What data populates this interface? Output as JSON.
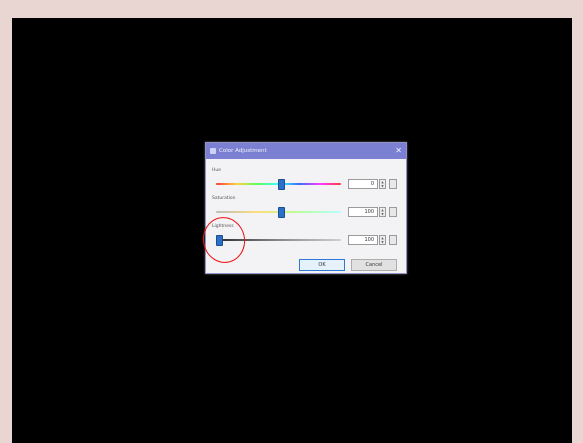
{
  "dialog": {
    "title": "Color Adjustment",
    "close_glyph": "✕",
    "sliders": [
      {
        "label": "Hue",
        "value": "0",
        "thumb_pos": 0.52
      },
      {
        "label": "Saturation",
        "value": "100",
        "thumb_pos": 0.52
      },
      {
        "label": "Lightness",
        "value": "100",
        "thumb_pos": 0.02
      }
    ],
    "ok_label": "OK",
    "cancel_label": "Cancel"
  },
  "icons": {
    "title": "palette-icon",
    "close": "close-icon",
    "spin_up": "▲",
    "spin_down": "▼"
  },
  "colors": {
    "screen": "#000000",
    "titlebar": "#7c80d2",
    "thumb": "#2a70c8",
    "annotation": "#e11111"
  }
}
